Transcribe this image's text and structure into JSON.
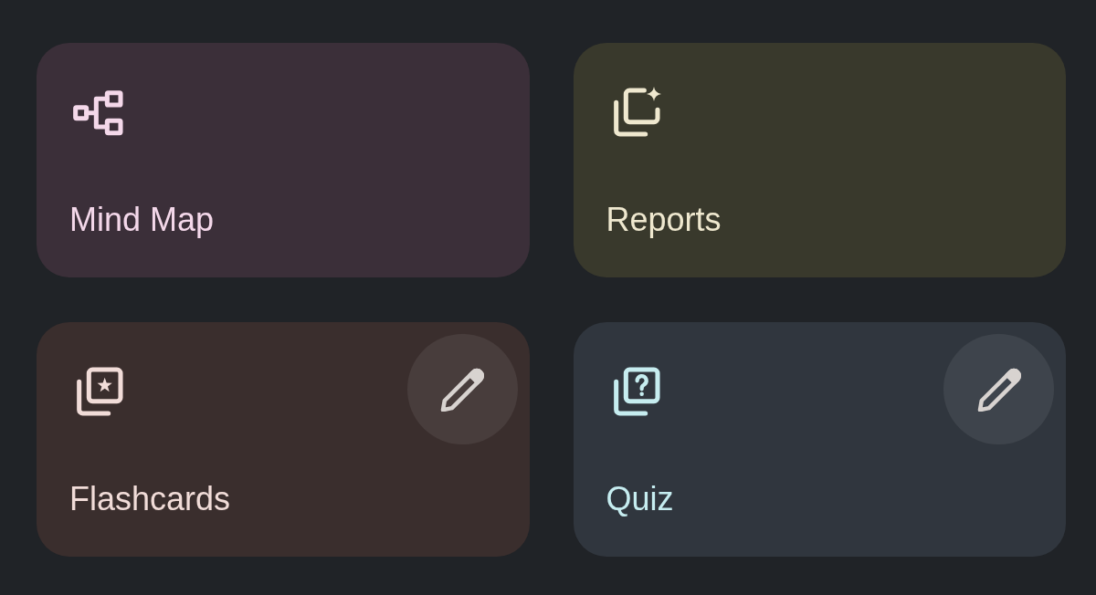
{
  "cards": [
    {
      "kind": "mind_map",
      "label": "Mind Map",
      "color": "#3b2f39",
      "editable": false
    },
    {
      "kind": "reports",
      "label": "Reports",
      "color": "#39392c",
      "editable": false
    },
    {
      "kind": "flashcards",
      "label": "Flashcards",
      "color": "#3a2e2d",
      "editable": true
    },
    {
      "kind": "quiz",
      "label": "Quiz",
      "color": "#30363e",
      "editable": true
    }
  ]
}
